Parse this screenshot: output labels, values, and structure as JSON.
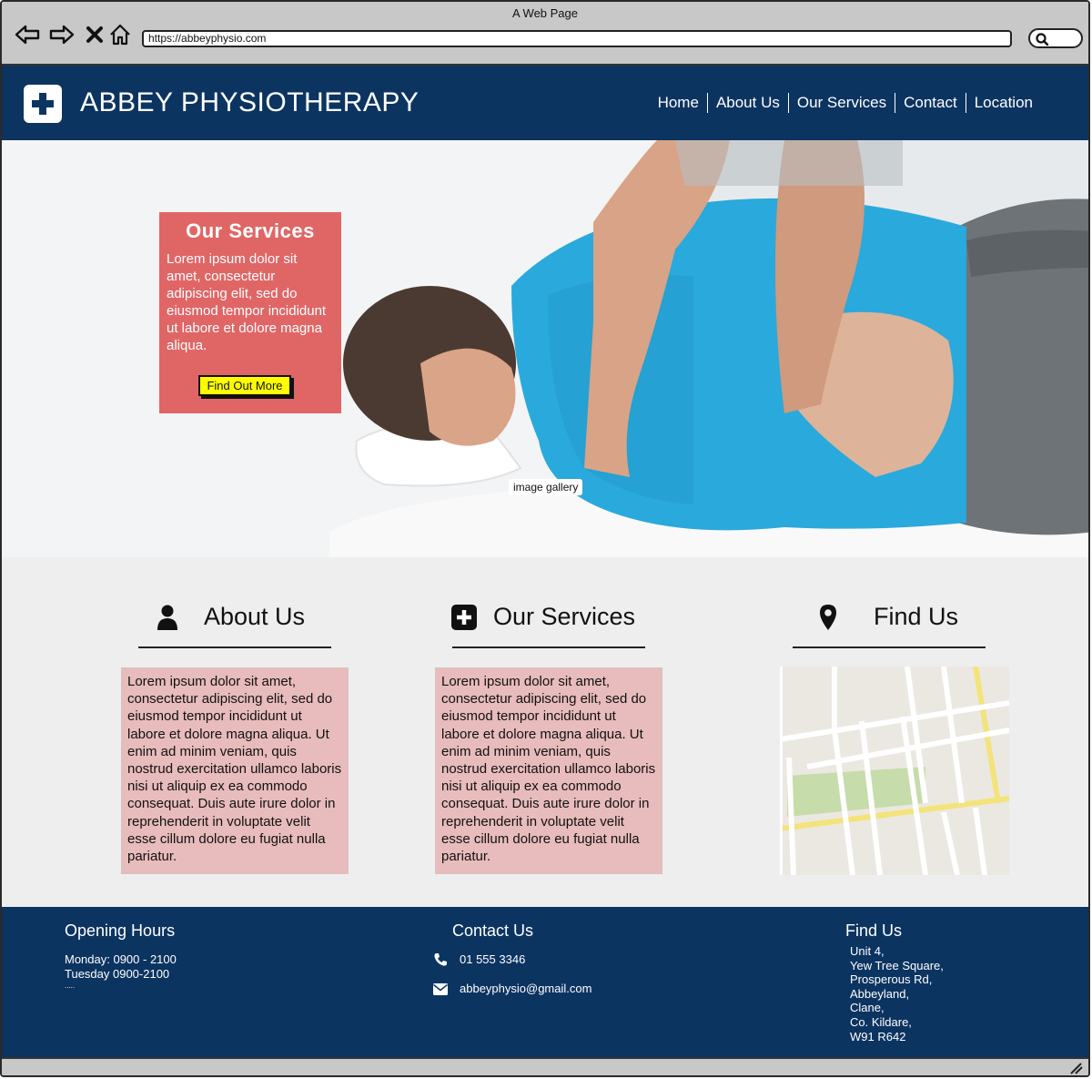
{
  "browser": {
    "window_title": "A Web Page",
    "url": "https://abbeyphysio.com"
  },
  "header": {
    "brand": "ABBEY PHYSIOTHERAPY",
    "nav": [
      "Home",
      "About Us",
      "Our Services",
      "Contact",
      "Location"
    ]
  },
  "hero": {
    "gallery_label": "image gallery",
    "card": {
      "title": "Our Services",
      "text": "Lorem ipsum dolor sit amet, consectetur adipiscing elit, sed do eiusmod tempor incididunt ut labore et dolore magna aliqua.",
      "button": "Find Out More"
    }
  },
  "sections": {
    "about": {
      "icon": "user-icon",
      "title": "About Us",
      "text": "Lorem ipsum dolor sit amet, consectetur adipiscing elit, sed do eiusmod tempor incididunt ut labore et dolore magna aliqua. Ut enim ad minim veniam, quis nostrud exercitation ullamco laboris nisi ut aliquip ex ea commodo consequat. Duis aute irure dolor in reprehenderit in voluptate velit esse cillum dolore eu fugiat nulla pariatur."
    },
    "services": {
      "icon": "plus-square-icon",
      "title": "Our Services",
      "text": "Lorem ipsum dolor sit amet, consectetur adipiscing elit, sed do eiusmod tempor incididunt ut labore et dolore magna aliqua. Ut enim ad minim veniam, quis nostrud exercitation ullamco laboris nisi ut aliquip ex ea commodo consequat. Duis aute irure dolor in reprehenderit in voluptate velit esse cillum dolore eu fugiat nulla pariatur."
    },
    "find": {
      "icon": "map-pin-icon",
      "title": "Find Us"
    }
  },
  "footer": {
    "hours": {
      "title": "Opening Hours",
      "lines": [
        "Monday: 0900 - 2100",
        "Tuesday 0900-2100",
        "....."
      ]
    },
    "contact": {
      "title": "Contact Us",
      "phone": "01 555 3346",
      "email": "abbeyphysio@gmail.com"
    },
    "find": {
      "title": "Find Us",
      "lines": [
        "Unit 4,",
        "Yew Tree Square,",
        "Prosperous Rd,",
        "Abbeyland,",
        "Clane,",
        "Co. Kildare,",
        "W91 R642"
      ]
    }
  },
  "colors": {
    "header_bg": "#0c3461",
    "card_bg": "#e06666",
    "button_bg": "#ffff00",
    "text_box_bg": "#e8bcbc"
  }
}
